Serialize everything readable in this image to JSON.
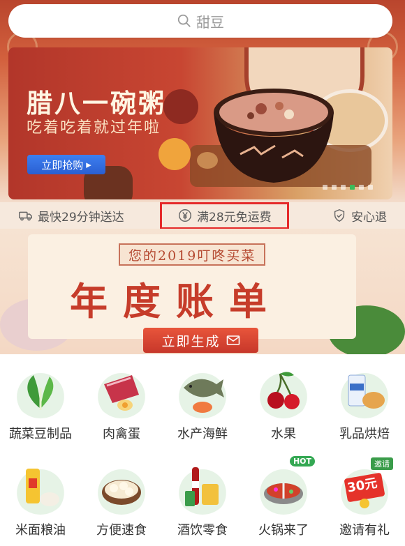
{
  "search": {
    "placeholder": "甜豆"
  },
  "banner": {
    "title": "腊八一碗粥",
    "subtitle": "吃着吃着就过年啦",
    "cta": "立即抢购",
    "cta_arrow": "▸",
    "carousel_pages": 6,
    "active_page": 4
  },
  "features": [
    {
      "icon": "delivery-truck-icon",
      "label": "最快29分钟送达"
    },
    {
      "icon": "yen-coin-icon",
      "label": "满28元免运费"
    },
    {
      "icon": "shield-check-icon",
      "label": "安心退"
    }
  ],
  "report": {
    "tagline": "您的2019叮咚买菜",
    "headline": "年度账单",
    "cta": "立即生成"
  },
  "categories": [
    {
      "label": "蔬菜豆制品",
      "icon": "vegetable-icon"
    },
    {
      "label": "肉禽蛋",
      "icon": "meat-egg-icon"
    },
    {
      "label": "水产海鲜",
      "icon": "fish-seafood-icon"
    },
    {
      "label": "水果",
      "icon": "cherry-fruit-icon"
    },
    {
      "label": "乳品烘焙",
      "icon": "milk-bread-icon"
    },
    {
      "label": "米面粮油",
      "icon": "rice-oil-icon"
    },
    {
      "label": "方便速食",
      "icon": "dumpling-icon"
    },
    {
      "label": "酒饮零食",
      "icon": "drink-snack-icon"
    },
    {
      "label": "火锅来了",
      "icon": "hotpot-icon",
      "badge": "HOT"
    },
    {
      "label": "邀请有礼",
      "icon": "coupon-gift-icon",
      "badge": "邀请",
      "coupon_value": "30元"
    }
  ],
  "colors": {
    "accent_red": "#c63c2a",
    "cta_blue": "#2a5fd2",
    "highlight_border": "#e52a2a",
    "badge_green": "#34a853"
  }
}
